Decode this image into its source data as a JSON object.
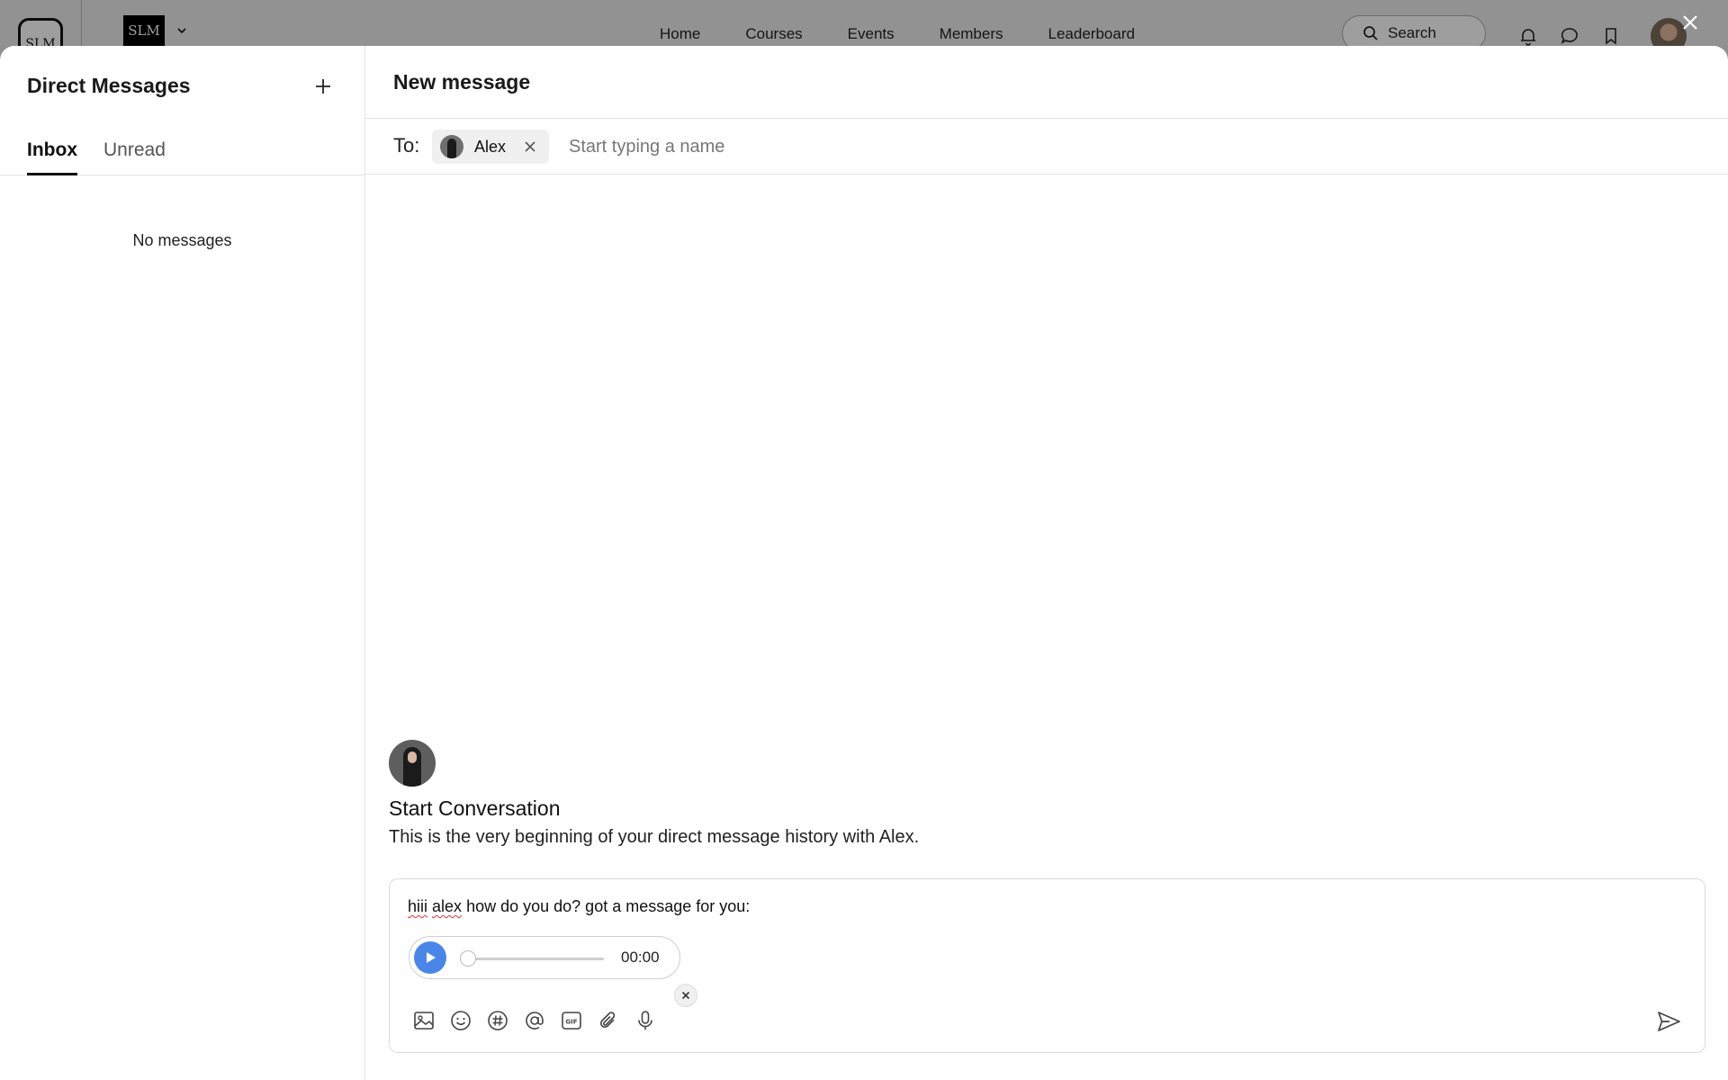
{
  "topbar": {
    "logo_text": "SLM",
    "brand_text": "SLM",
    "nav": [
      "Home",
      "Courses",
      "Events",
      "Members",
      "Leaderboard"
    ],
    "search_label": "Search"
  },
  "sidebar": {
    "title": "Direct Messages",
    "tabs": {
      "inbox": "Inbox",
      "unread": "Unread"
    },
    "empty_text": "No messages"
  },
  "main": {
    "title": "New message",
    "to_label": "To:",
    "recipient": {
      "name": "Alex"
    },
    "to_placeholder": "Start typing a name",
    "conversation": {
      "title": "Start Conversation",
      "subtitle": "This is the very beginning of your direct message history with Alex."
    },
    "composer": {
      "text_word1": "hiii",
      "text_word2": "alex",
      "text_rest": "how do you do? got a message for you:",
      "audio": {
        "time": "00:00",
        "progress": 0
      }
    }
  },
  "colors": {
    "accent": "#4a86e8",
    "overlay": "#8f8f8f"
  }
}
